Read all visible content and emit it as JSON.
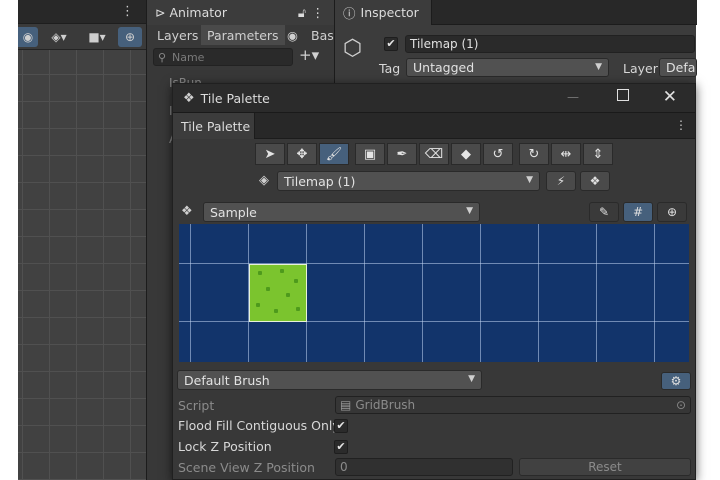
{
  "scene": {
    "toolbar_icons": [
      "layers-icon",
      "camera-icon",
      "gizmo-target-icon"
    ]
  },
  "animator": {
    "tab_title": "Animator",
    "subtabs": [
      "Layers",
      "Parameters",
      "Base"
    ],
    "search_placeholder": "Name",
    "param_partial": [
      "IsRun",
      "Is",
      "A"
    ]
  },
  "inspector": {
    "tab_title": "Inspector",
    "object_name": "Tilemap (1)",
    "tag_label": "Tag",
    "tag_value": "Untagged",
    "layer_label": "Layer",
    "layer_value": "Defau"
  },
  "palette": {
    "window_title": "Tile Palette",
    "tab_label": "Tile Palette",
    "tools": [
      "select-tool",
      "move-tool",
      "paint-brush-tool",
      "box-fill-tool",
      "picker-tool",
      "eraser-tool",
      "fill-tool",
      "rotate-ccw-tool",
      "rotate-cw-tool",
      "flip-x-tool",
      "flip-y-tool"
    ],
    "active_tool_index": 2,
    "target_tilemap": "Tilemap (1)",
    "palette_name": "Sample",
    "brush_name": "Default Brush",
    "properties": {
      "script_label": "Script",
      "script_value": "GridBrush",
      "flood_fill_label": "Flood Fill Contiguous Only",
      "flood_fill_checked": true,
      "lock_z_label": "Lock Z Position",
      "lock_z_checked": true,
      "scene_z_label": "Scene View Z Position",
      "scene_z_value": "0",
      "reset_label": "Reset"
    },
    "colors": {
      "grid_background": "#12346b",
      "tile_green": "#7bc42e",
      "active_tool": "#46607c"
    }
  }
}
